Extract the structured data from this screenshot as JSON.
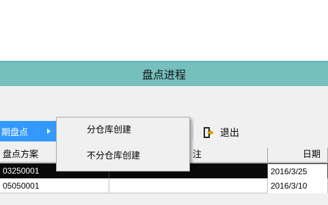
{
  "window": {
    "title": "盘点进程"
  },
  "toolbar": {
    "active_menu_label": "期盘点",
    "exit_label": "退出"
  },
  "submenu": {
    "items": [
      {
        "label": "分仓库创建"
      },
      {
        "label": "不分仓库创建"
      }
    ]
  },
  "table": {
    "headers": [
      "盘点方案",
      "注",
      "日期"
    ],
    "rows": [
      {
        "plan": "03250001",
        "note": "",
        "date": "2016/3/25"
      },
      {
        "plan": "05050001",
        "note": "",
        "date": "2016/3/10"
      }
    ]
  },
  "colors": {
    "title_bar": "#75c0bd",
    "menu_highlight": "#3399ff",
    "selected_row": "#0a0a0a"
  }
}
